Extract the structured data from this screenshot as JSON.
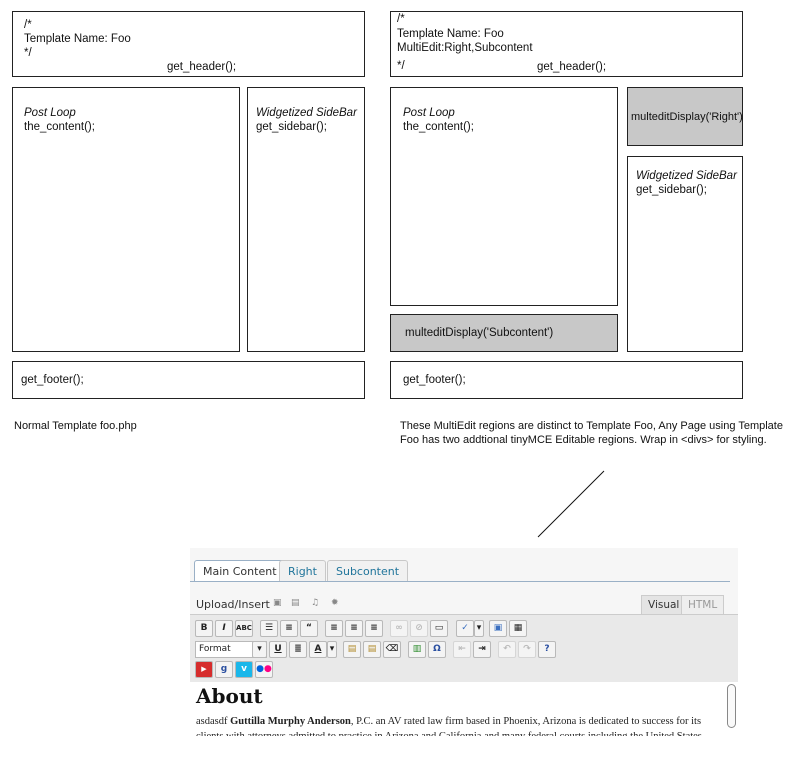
{
  "left": {
    "header_lines": [
      "/*",
      "Template Name: Foo",
      "*/"
    ],
    "header_call": "get_header();",
    "post_loop_title": "Post Loop",
    "post_loop_call": "the_content();",
    "sidebar_title": "Widgetized SideBar",
    "sidebar_call": "get_sidebar();",
    "footer_call": "get_footer();",
    "caption": "Normal Template foo.php"
  },
  "right": {
    "header_lines": [
      "/*",
      "Template Name: Foo",
      "MultiEdit:Right,Subcontent",
      "*/"
    ],
    "header_call": "get_header();",
    "post_loop_title": "Post Loop",
    "post_loop_call": "the_content();",
    "right_region": "multeditDisplay('Right')",
    "sidebar_title": "Widgetized SideBar",
    "sidebar_call": "get_sidebar();",
    "subcontent_region": "multeditDisplay('Subcontent')",
    "footer_call": "get_footer();",
    "caption": "These MultiEdit regions are distinct to Template Foo, Any Page using Template Foo has two addtional tinyMCE Editable regions. Wrap in <divs> for styling."
  },
  "editor": {
    "tabs": [
      "Main Content",
      "Right",
      "Subcontent"
    ],
    "upload_label": "Upload/Insert",
    "view_tabs": [
      "Visual",
      "HTML"
    ],
    "format_label": "Format",
    "heading": "About",
    "para_lead": "asdasdf ",
    "para_bold": "Guttilla Murphy Anderson",
    "para_rest": ", P.C. an AV rated law firm based in Phoenix, Arizona is dedicated to success for its clients with attorneys admitted to practice in Arizona and California and many federal courts including the United States"
  }
}
